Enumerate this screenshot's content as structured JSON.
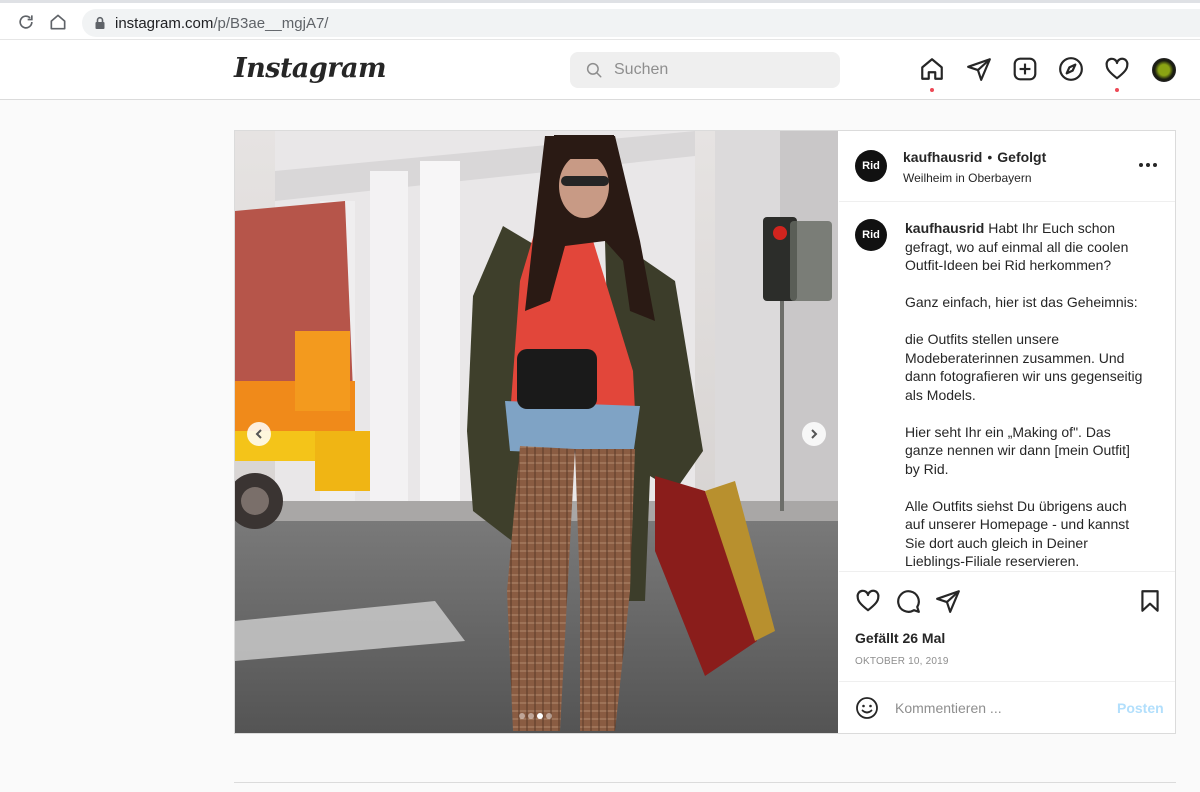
{
  "browser": {
    "url_host": "instagram.com",
    "url_path": "/p/B3ae__mgjA7/"
  },
  "header": {
    "logo": "Instagram",
    "search_placeholder": "Suchen",
    "icons": [
      "home-icon",
      "direct-icon",
      "new-post-icon",
      "explore-icon",
      "activity-icon",
      "profile-avatar"
    ]
  },
  "post": {
    "username": "kaufhausrid",
    "separator": "•",
    "follow_status": "Gefolgt",
    "location": "Weilheim in Oberbayern",
    "avatar_text": "Rid",
    "caption_text": " Habt Ihr Euch schon gefragt, wo auf einmal all die coolen Outfit-Ideen bei Rid herkommen?\n\nGanz einfach, hier ist das Geheimnis:\n\ndie Outfits stellen unsere Modeberaterinnen zusammen. Und dann fotografieren wir uns gegenseitig als Models.\n\nHier seht Ihr ein „Making of\". Das ganze nennen wir dann [mein Outfit] by Rid.\n\nAlle Outfits siehst Du übrigens auch auf unserer Homepage - und kannst Sie dort auch gleich in Deiner Lieblings-Filiale reservieren.",
    "likes": "Gefällt 26 Mal",
    "date": "OKTOBER 10, 2019",
    "comment_placeholder": "Kommentieren ...",
    "post_button": "Posten",
    "carousel": {
      "count": 4,
      "active_index": 2
    }
  },
  "colors": {
    "notification_dot": "#ed4956",
    "post_button_disabled": "#b2dffc",
    "border": "#dbdbdb"
  }
}
